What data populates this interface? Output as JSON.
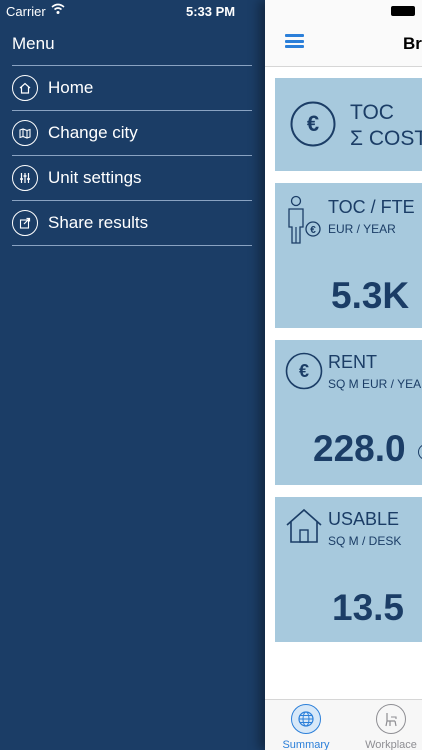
{
  "status": {
    "carrier": "Carrier",
    "time": "5:33 PM"
  },
  "menu": {
    "title": "Menu",
    "items": [
      {
        "label": "Home",
        "icon": "home-icon"
      },
      {
        "label": "Change city",
        "icon": "map-icon"
      },
      {
        "label": "Unit settings",
        "icon": "sliders-icon"
      },
      {
        "label": "Share results",
        "icon": "share-icon"
      }
    ]
  },
  "header": {
    "title": "Br"
  },
  "cards": [
    {
      "heading": "TOC",
      "sub": "Σ COST",
      "icon": "euro-icon"
    },
    {
      "heading": "TOC / FTE",
      "sub": "EUR / YEAR",
      "value": "5.3K",
      "icon": "person-euro-icon"
    },
    {
      "heading": "RENT",
      "sub": "SQ M EUR / YEA",
      "value": "228.0",
      "icon": "euro-icon"
    },
    {
      "heading": "USABLE",
      "sub": "SQ M / DESK",
      "value": "13.5",
      "icon": "house-icon"
    }
  ],
  "tabs": [
    {
      "label": "Summary",
      "icon": "globe-icon",
      "color": "#2b7fd9"
    },
    {
      "label": "Workplace",
      "icon": "chair-icon",
      "color": "#8e8e93"
    }
  ]
}
